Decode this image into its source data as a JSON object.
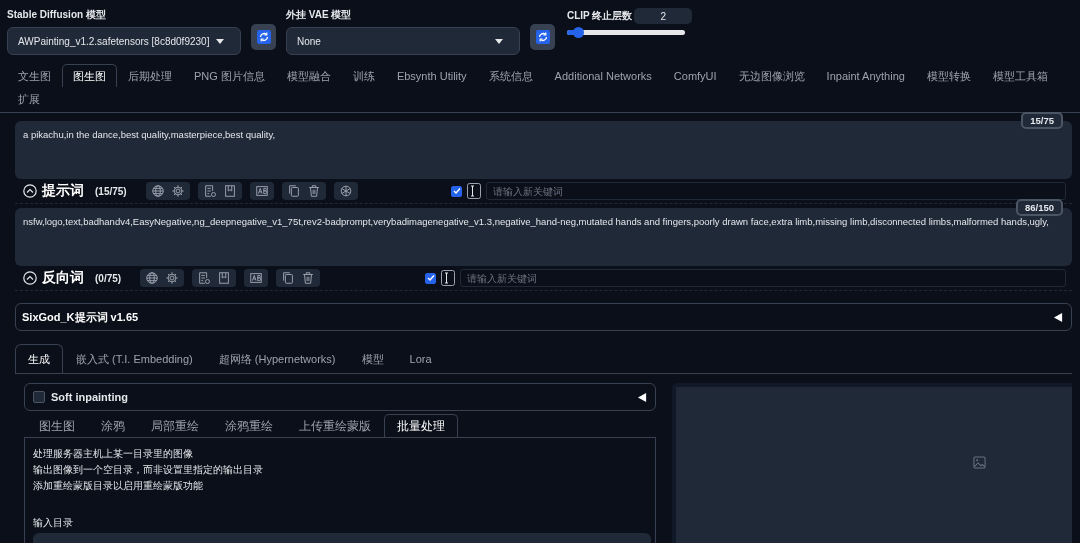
{
  "models": [
    {
      "label": "Stable Diffusion 模型",
      "value": "AWPainting_v1.2.safetensors [8c8d0f9230]"
    },
    {
      "label": "外挂 VAE 模型",
      "value": "None"
    }
  ],
  "clip": {
    "label": "CLIP 终止层数",
    "value": "2",
    "level": 0.09
  },
  "tabs": [
    {
      "label": "文生图",
      "selected": false
    },
    {
      "label": "图生图",
      "selected": true
    },
    {
      "label": "后期处理",
      "selected": false
    },
    {
      "label": "PNG 图片信息",
      "selected": false
    },
    {
      "label": "模型融合",
      "selected": false
    },
    {
      "label": "训练",
      "selected": false
    },
    {
      "label": "Ebsynth Utility",
      "selected": false
    },
    {
      "label": "系统信息",
      "selected": false
    },
    {
      "label": "Additional Networks",
      "selected": false
    },
    {
      "label": "ComfyUI",
      "selected": false
    },
    {
      "label": "无边图像浏览",
      "selected": false
    },
    {
      "label": "Inpaint Anything",
      "selected": false
    },
    {
      "label": "模型转换",
      "selected": false
    },
    {
      "label": "模型工具箱",
      "selected": false
    },
    {
      "label": "扩展",
      "selected": false
    }
  ],
  "prompts": [
    {
      "text": "a pikachu,in the dance,best quality,masterpiece,best quality,",
      "counter": "15/75",
      "title": "提示词",
      "count": "(15/75)",
      "extra_tool": true,
      "auto": true,
      "placeholder": "请输入新关键词"
    },
    {
      "text": "nsfw,logo,text,badhandv4,EasyNegative,ng_deepnegative_v1_75t,rev2-badprompt,verybadimagenegative_v1.3,negative_hand-neg,mutated hands and fingers,poorly drawn face,extra limb,missing limb,disconnected limbs,malformed hands,ugly,",
      "counter": "86/150",
      "title": "反向词",
      "count": "(0/75)",
      "extra_tool": false,
      "auto": true,
      "placeholder": "请输入新关键词"
    }
  ],
  "extension": {
    "title": "SixGod_K提示词 v1.65",
    "expanded": false
  },
  "section_tabs": [
    {
      "label": "生成",
      "selected": true
    },
    {
      "label": "嵌入式 (T.I. Embedding)",
      "selected": false
    },
    {
      "label": "超网络 (Hypernetworks)",
      "selected": false
    },
    {
      "label": "模型",
      "selected": false
    },
    {
      "label": "Lora",
      "selected": false
    }
  ],
  "soft_inpainting": {
    "label": "Soft inpainting",
    "checked": false,
    "expanded": false
  },
  "mode_tabs": [
    {
      "label": "图生图",
      "selected": false
    },
    {
      "label": "涂鸦",
      "selected": false
    },
    {
      "label": "局部重绘",
      "selected": false
    },
    {
      "label": "涂鸦重绘",
      "selected": false
    },
    {
      "label": "上传重绘蒙版",
      "selected": false
    },
    {
      "label": "批量处理",
      "selected": true
    }
  ],
  "batch": {
    "lines": [
      "处理服务器主机上某一目录里的图像",
      "输出图像到一个空目录，而非设置里指定的输出目录",
      "添加重绘蒙版目录以启用重绘蒙版功能"
    ],
    "input_label": "输入目录"
  }
}
